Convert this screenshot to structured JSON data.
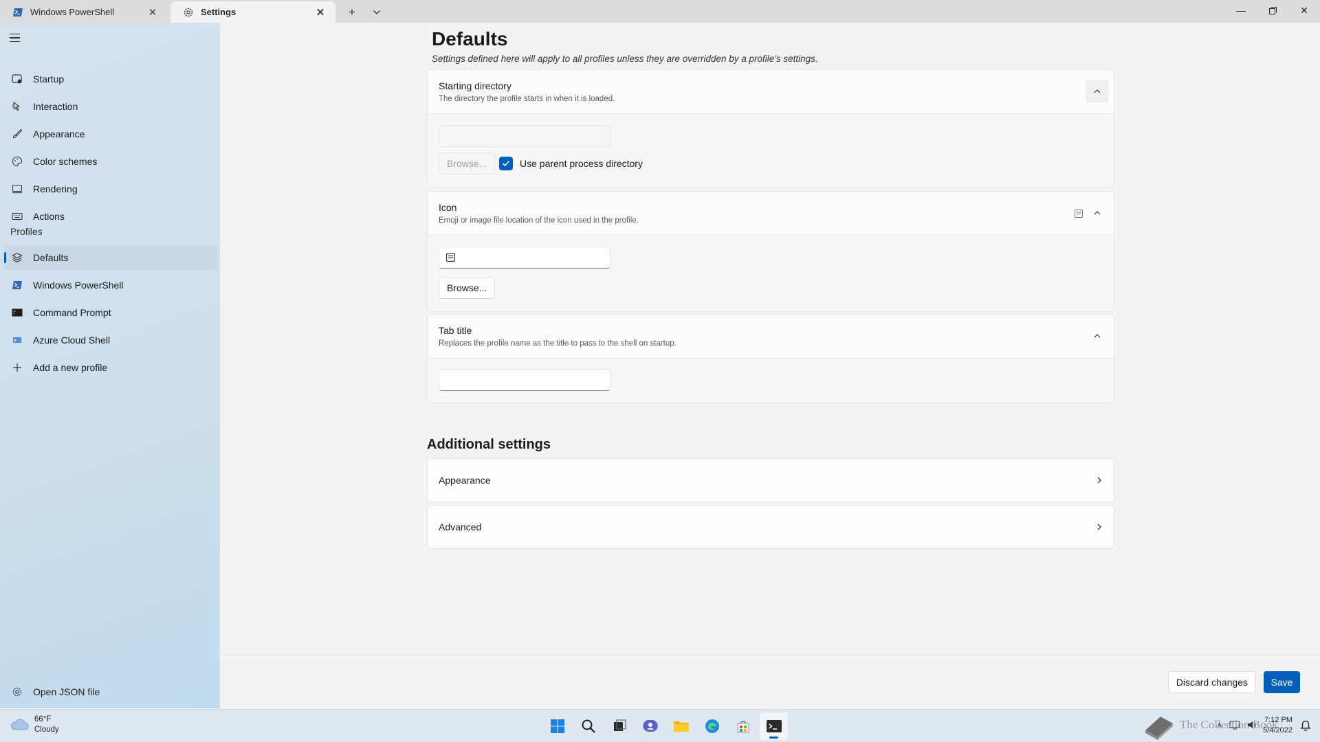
{
  "tabs": [
    {
      "label": "Windows PowerShell",
      "icon": "powershell-icon"
    },
    {
      "label": "Settings",
      "icon": "gear-icon"
    }
  ],
  "sidebar": {
    "items": [
      {
        "label": "Startup",
        "icon": "startup-icon"
      },
      {
        "label": "Interaction",
        "icon": "interaction-icon"
      },
      {
        "label": "Appearance",
        "icon": "brush-icon"
      },
      {
        "label": "Color schemes",
        "icon": "palette-icon"
      },
      {
        "label": "Rendering",
        "icon": "monitor-icon"
      },
      {
        "label": "Actions",
        "icon": "keyboard-icon"
      }
    ],
    "profiles_header": "Profiles",
    "profiles": [
      {
        "label": "Defaults",
        "icon": "layers-icon",
        "selected": true
      },
      {
        "label": "Windows PowerShell",
        "icon": "powershell-icon"
      },
      {
        "label": "Command Prompt",
        "icon": "cmd-icon"
      },
      {
        "label": "Azure Cloud Shell",
        "icon": "azure-icon"
      },
      {
        "label": "Add a new profile",
        "icon": "plus-icon"
      }
    ],
    "open_json": "Open JSON file"
  },
  "page": {
    "title": "Defaults",
    "subtitle": "Settings defined here will apply to all profiles unless they are overridden by a profile's settings."
  },
  "starting_directory": {
    "title": "Starting directory",
    "description": "The directory the profile starts in when it is loaded.",
    "value": "",
    "browse_label": "Browse...",
    "checkbox_label": "Use parent process directory",
    "checked": true
  },
  "icon_setting": {
    "title": "Icon",
    "description": "Emoji or image file location of the icon used in the profile.",
    "value": "",
    "browse_label": "Browse..."
  },
  "tab_title": {
    "title": "Tab title",
    "description": "Replaces the profile name as the title to pass to the shell on startup.",
    "value": ""
  },
  "additional": {
    "title": "Additional settings",
    "items": [
      "Appearance",
      "Advanced"
    ]
  },
  "footer": {
    "discard_label": "Discard changes",
    "save_label": "Save"
  },
  "taskbar": {
    "temperature": "66°F",
    "condition": "Cloudy",
    "time": "7:12 PM",
    "date": "5/4/2022",
    "watermark": "The Collection Book",
    "apps": [
      "start-icon",
      "search-icon",
      "task-view-icon",
      "chat-icon",
      "file-explorer-icon",
      "edge-icon",
      "store-icon",
      "terminal-icon"
    ]
  },
  "colors": {
    "accent": "#005fb8",
    "sidebar_bg": "#d4e2ee",
    "content_bg": "#f3f3f3"
  }
}
